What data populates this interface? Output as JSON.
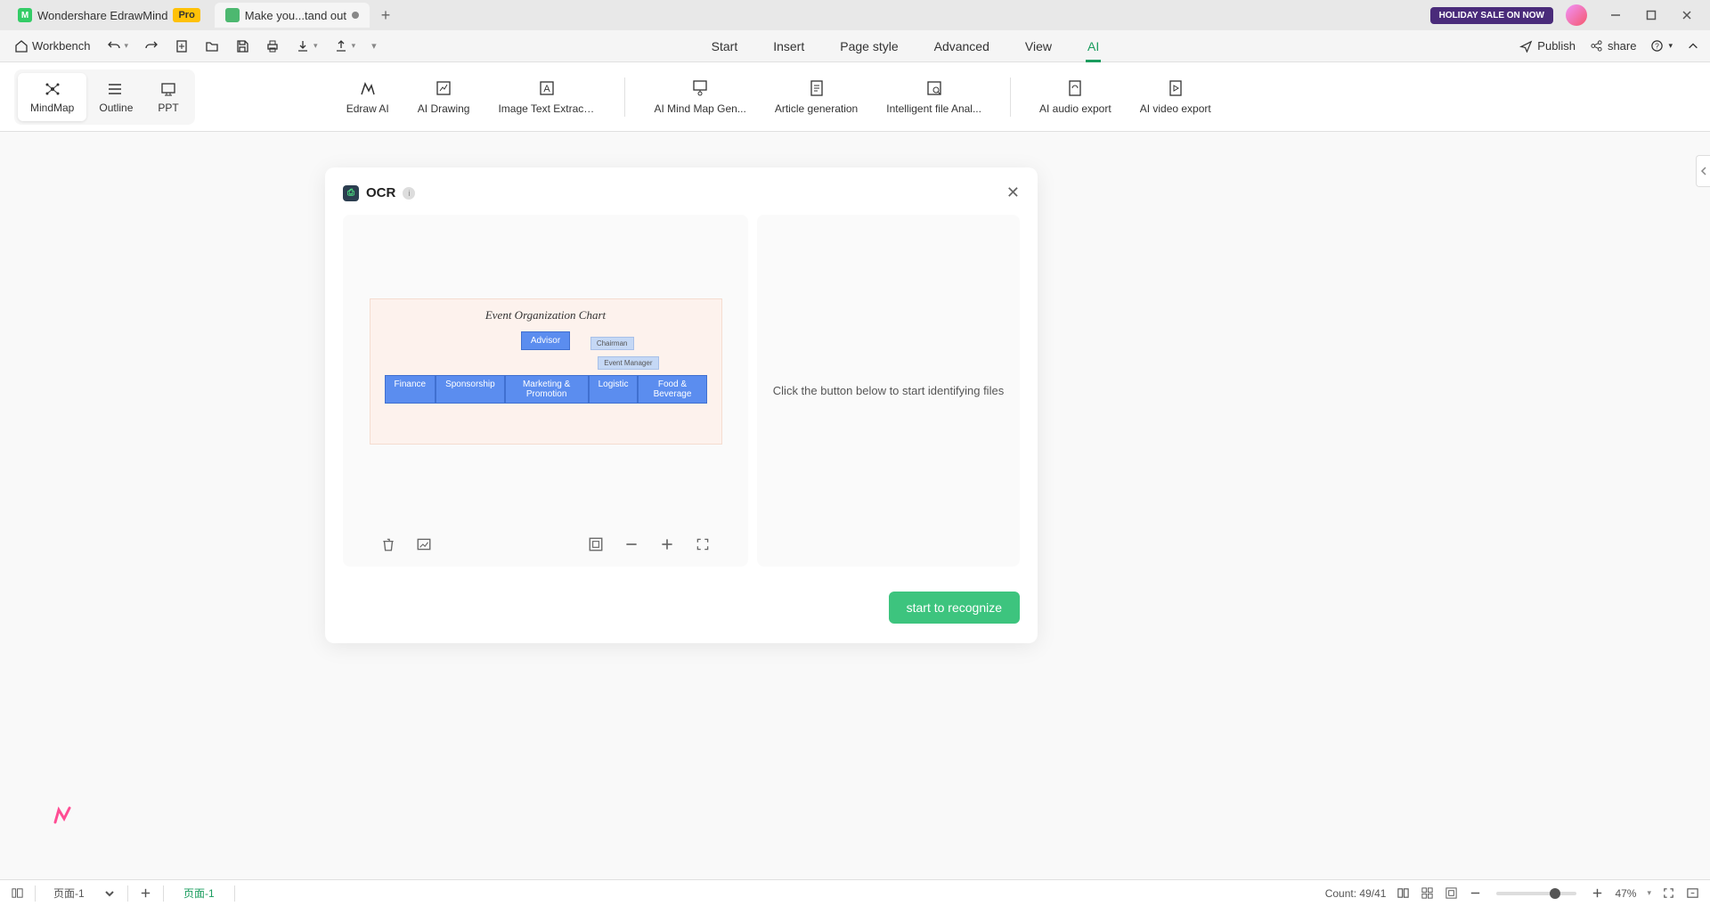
{
  "titlebar": {
    "app_name": "Wondershare EdrawMind",
    "pro_badge": "Pro",
    "doc_tab": "Make you...tand out",
    "holiday": "HOLIDAY SALE ON NOW"
  },
  "toolbar": {
    "workbench": "Workbench",
    "menus": [
      "Start",
      "Insert",
      "Page style",
      "Advanced",
      "View",
      "AI"
    ],
    "active_menu": 5,
    "publish": "Publish",
    "share": "share"
  },
  "ribbon": {
    "views": [
      "MindMap",
      "Outline",
      "PPT"
    ],
    "active_view": 0,
    "ai_tools_1": [
      "Edraw AI",
      "AI Drawing",
      "Image Text Extracti..."
    ],
    "ai_tools_2": [
      "AI Mind Map Gen...",
      "Article generation",
      "Intelligent file Anal..."
    ],
    "ai_tools_3": [
      "AI audio export",
      "AI video export"
    ]
  },
  "ocr": {
    "title": "OCR",
    "hint": "Click the button below to start identifying files",
    "recognize": "start to recognize",
    "preview": {
      "title": "Event Organization Chart",
      "top": "Advisor",
      "side1": "Chairman",
      "side2": "Event Manager",
      "row": [
        "Finance",
        "Sponsorship",
        "Marketing & Promotion",
        "Logistic",
        "Food & Beverage"
      ]
    }
  },
  "statusbar": {
    "page_select": "页面-1",
    "page_tab": "页面-1",
    "count": "Count: 49/41",
    "zoom": "47%"
  }
}
